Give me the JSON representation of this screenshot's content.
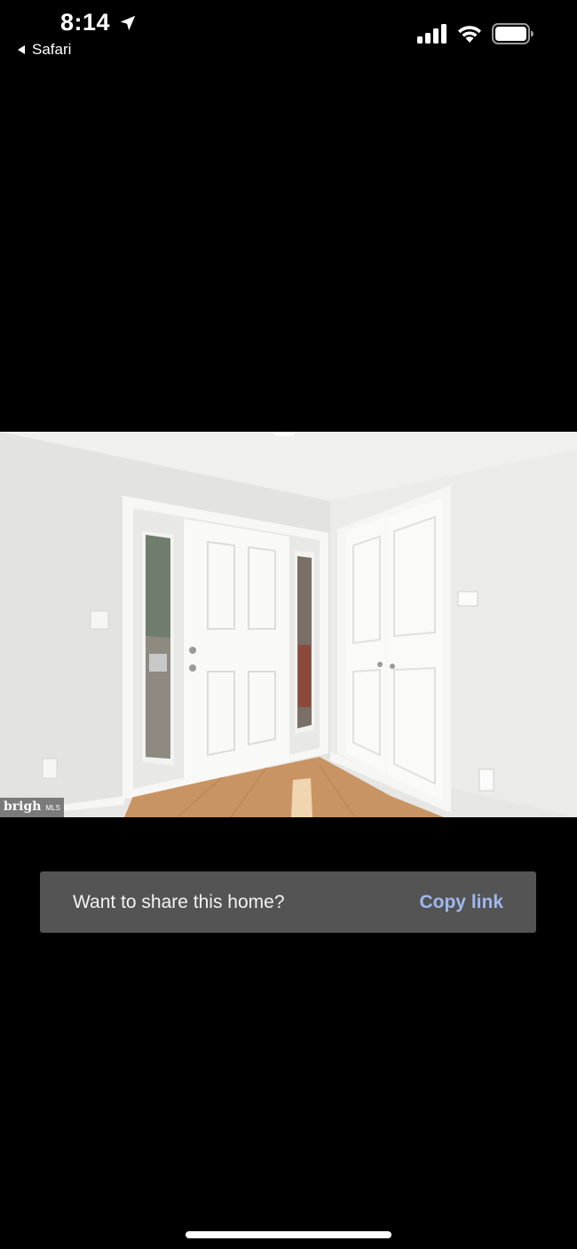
{
  "status_bar": {
    "time": "8:14",
    "back_app_label": "Safari",
    "icons": [
      "location-arrow-icon",
      "cellular-signal-icon",
      "wifi-icon",
      "battery-icon"
    ]
  },
  "photo": {
    "watermark_main": "brigh",
    "watermark_small": "MLS"
  },
  "share_banner": {
    "message": "Want to share this home?",
    "action_label": "Copy link",
    "action_color": "#9fb8f0",
    "background_color": "#545454"
  }
}
